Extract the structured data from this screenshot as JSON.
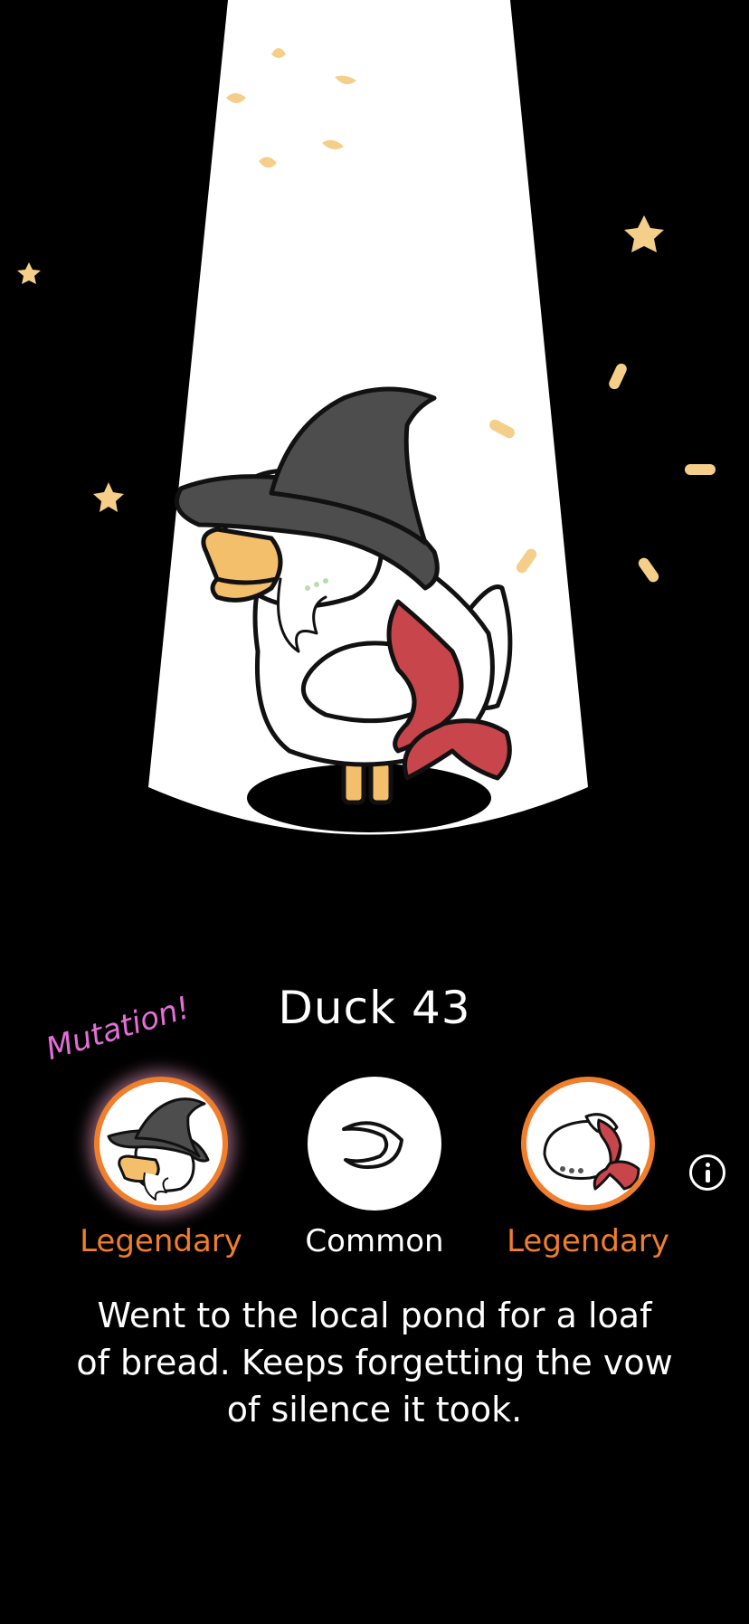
{
  "duck": {
    "name": "Duck 43",
    "mutation_label": "Mutation!",
    "description": "Went to the local pond for a loaf of bread. Keeps forgetting the vow of silence it took."
  },
  "traits": [
    {
      "part": "hat",
      "rarity": "Legendary",
      "icon": "witch-hat-beard-icon",
      "mutation": true
    },
    {
      "part": "eyes",
      "rarity": "Common",
      "icon": "closed-eye-icon",
      "mutation": false
    },
    {
      "part": "accessory",
      "rarity": "Legendary",
      "icon": "red-bandana-icon",
      "mutation": false
    }
  ],
  "colors": {
    "background": "#000000",
    "spotlight": "#ffffff",
    "legendary": "#f07e2a",
    "common": "#ffffff",
    "mutation": "#e36fd6",
    "confetti": "#f5cf8a",
    "bandana": "#c8454b",
    "hat": "#4d4d4d",
    "beak": "#f4bf6a"
  },
  "icons": {
    "info": "info-icon"
  }
}
